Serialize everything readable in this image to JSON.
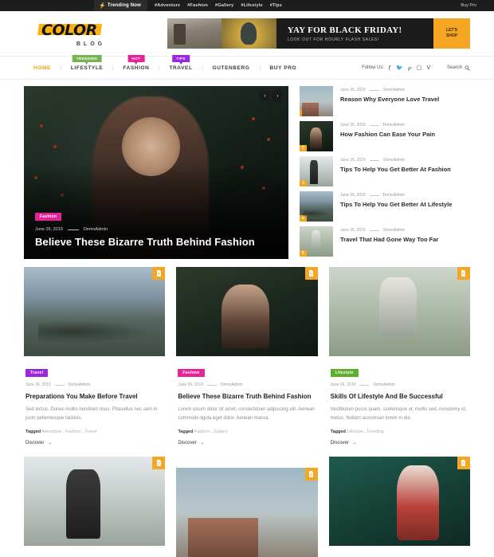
{
  "topbar": {
    "trending_label": "Trending Now",
    "bolt_icon": "lightning-bolt-icon",
    "tags": [
      "#Adventure",
      "#Fashion",
      "#Gallery",
      "#Lifestyle",
      "#Tips"
    ],
    "buy_pro": "Buy Pro"
  },
  "header": {
    "logo_text": "COLOR",
    "logo_sub": "BLOG",
    "banner": {
      "title": "YAY FOR BLACK FRIDAY!",
      "subtitle": "LOOK OUT FOR HOURLY FLASH SALES!",
      "cta_line1": "LET'S",
      "cta_line2": "SHOP"
    }
  },
  "nav": {
    "items": [
      {
        "label": "HOME",
        "badge": null,
        "active": true
      },
      {
        "label": "LIFESTYLE",
        "badge": "TRENDING",
        "badge_color": "#74b551",
        "active": false
      },
      {
        "label": "FASHION",
        "badge": "HOT",
        "badge_color": "#e8229b",
        "active": false
      },
      {
        "label": "TRAVEL",
        "badge": "TIPS",
        "badge_color": "#9c27e0",
        "active": false
      },
      {
        "label": "GUTENBERG",
        "badge": null,
        "active": false
      },
      {
        "label": "BUY PRO",
        "badge": null,
        "active": false
      }
    ],
    "follow_label": "Follow Us:",
    "social": [
      "facebook-icon",
      "twitter-icon",
      "pinterest-icon",
      "instagram-icon",
      "vimeo-icon"
    ],
    "search_label": "Search",
    "search_icon": "search-icon"
  },
  "hero": {
    "category": "Fashion",
    "category_color": "#e8229b",
    "date": "June 26, 2019",
    "author": "DemoAdmin",
    "title": "Believe These Bizarre Truth Behind Fashion",
    "prev_icon": "‹",
    "next_icon": "›"
  },
  "sidebar_posts": [
    {
      "num": "1",
      "date": "June 26, 2019",
      "author": "DemoAdmin",
      "title": "Reason Why Everyone Love Travel"
    },
    {
      "num": "2",
      "date": "June 26, 2019",
      "author": "DemoAdmin",
      "title": "How Fashion Can Ease Your Pain"
    },
    {
      "num": "3",
      "date": "June 26, 2019",
      "author": "DemoAdmin",
      "title": "Tips To Help You Get Better At Fashion"
    },
    {
      "num": "4",
      "date": "June 26, 2019",
      "author": "DemoAdmin",
      "title": "Tips To Help You Get Better At Lifestyle"
    },
    {
      "num": "5",
      "date": "June 26, 2019",
      "author": "DemoAdmin",
      "title": "Travel That Had Gone Way Too Far"
    }
  ],
  "cards": [
    {
      "category": "Travel",
      "category_color": "#9c27e0",
      "date": "June 26, 2019",
      "author": "DemoAdmin",
      "title": "Preparations You Make Before Travel",
      "excerpt": "Sed lectus. Donec mollis hendrerit risus. Phasellus nec sem in justo pellentesque facilisis.",
      "tagged_label": "Tagged",
      "tags": "Adventure , Fashion , Travel",
      "discover": "Discover",
      "arrow": "→",
      "format_icon": "document-icon"
    },
    {
      "category": "Fashion",
      "category_color": "#e8229b",
      "date": "June 26, 2019",
      "author": "DemoAdmin",
      "title": "Believe These Bizarre Truth Behind Fashion",
      "excerpt": "Lorem ipsum dolor sit amet, consectetuer adipiscing elit. Aenean commodo ligula eget dolor. Aenean massa.",
      "tagged_label": "Tagged",
      "tags": "Fashion , Gallery",
      "discover": "Discover",
      "arrow": "→",
      "format_icon": "document-icon"
    },
    {
      "category": "Lifestyle",
      "category_color": "#5bb02e",
      "date": "June 26, 2019",
      "author": "DemoAdmin",
      "title": "Skills Of Lifestyle And Be Successful",
      "excerpt": "Vestibulum purus quam, scelerisque ut, mollis sed, nonummy id, metus. Nullam accumsan lorem in dui.",
      "tagged_label": "Tagged",
      "tags": "Lifestyle , Trending",
      "discover": "Discover",
      "arrow": "→",
      "format_icon": "document-icon"
    }
  ],
  "cards_row2": [
    {
      "format_icon": "document-icon"
    },
    {
      "format_icon": "document-icon"
    },
    {
      "format_icon": "document-icon"
    }
  ]
}
